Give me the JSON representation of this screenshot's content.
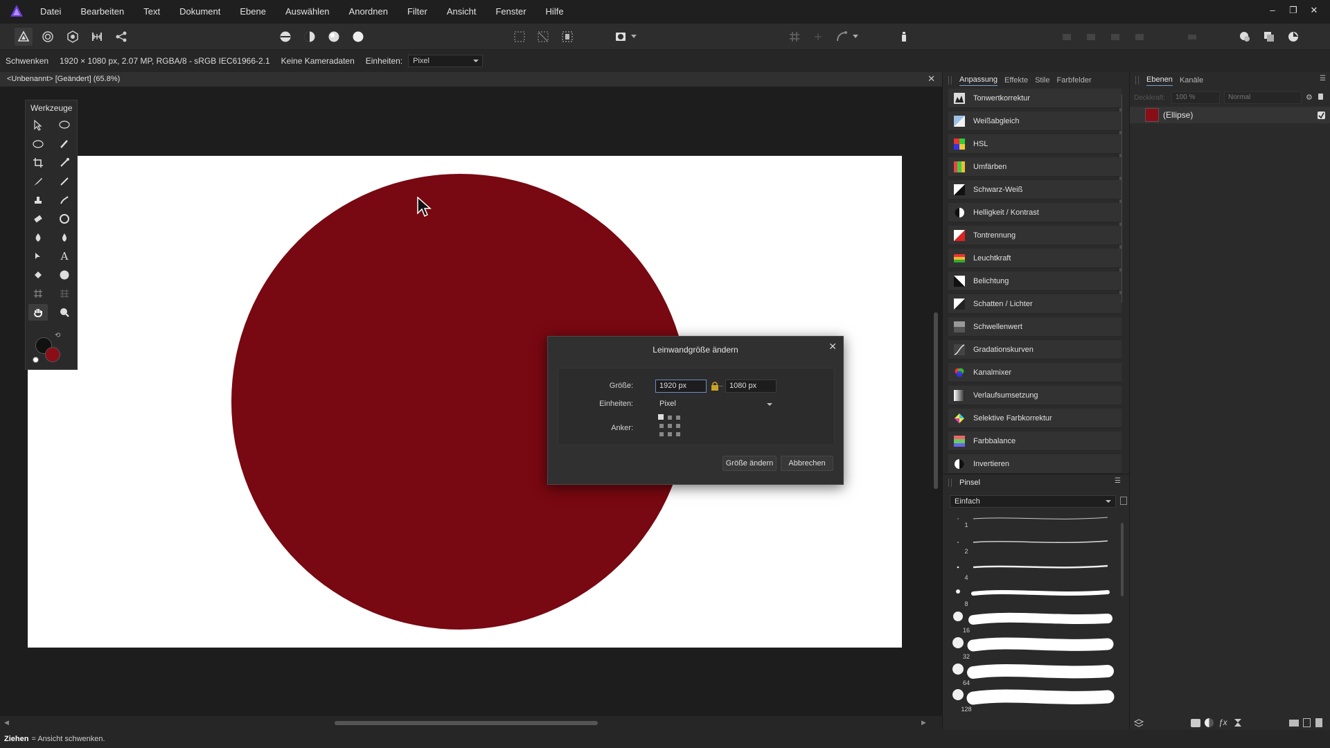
{
  "app": {
    "menu": [
      "Datei",
      "Bearbeiten",
      "Text",
      "Dokument",
      "Ebene",
      "Auswählen",
      "Anordnen",
      "Filter",
      "Ansicht",
      "Fenster",
      "Hilfe"
    ],
    "window_controls": [
      "–",
      "❐",
      "✕"
    ]
  },
  "context": {
    "tool_name": "Schwenken",
    "doc_info": "1920 × 1080 px, 2.07 MP, RGBA/8 - sRGB IEC61966-2.1",
    "camera": "Keine Kameradaten",
    "units_label": "Einheiten:",
    "units_value": "Pixel"
  },
  "document": {
    "tab_label": "<Unbenannt> [Geändert] (65.8%)",
    "tab_close": "✕",
    "ellipse_color": "#780811",
    "canvas_color": "#ffffff"
  },
  "tools": {
    "title": "Werkzeuge",
    "primary_color": "#111111",
    "secondary_color": "#8a0e18"
  },
  "dialog": {
    "title": "Leinwandgröße ändern",
    "close": "✕",
    "size_label": "Größe:",
    "width_value": "1920 px",
    "height_value": "1080 px",
    "units_label": "Einheiten:",
    "units_value": "Pixel",
    "anchor_label": "Anker:",
    "ok_label": "Größe ändern",
    "cancel_label": "Abbrechen"
  },
  "adjustments": {
    "tabs": [
      "Anpassung",
      "Effekte",
      "Stile",
      "Farbfelder"
    ],
    "items": [
      "Tonwertkorrektur",
      "Weißabgleich",
      "HSL",
      "Umfärben",
      "Schwarz-Weiß",
      "Helligkeit / Kontrast",
      "Tontrennung",
      "Leuchtkraft",
      "Belichtung",
      "Schatten / Lichter",
      "Schwellenwert",
      "Gradationskurven",
      "Kanalmixer",
      "Verlaufsumsetzung",
      "Selektive Farbkorrektur",
      "Farbbalance",
      "Invertieren"
    ]
  },
  "brushes": {
    "tab": "Pinsel",
    "category": "Einfach",
    "sizes": [
      "1",
      "2",
      "4",
      "8",
      "16",
      "32",
      "64",
      "128"
    ]
  },
  "layers": {
    "tabs": [
      "Ebenen",
      "Kanäle"
    ],
    "opacity_label": "Deckkraft:",
    "opacity_value": "100 %",
    "blend_mode": "Normal",
    "layer_name": "(Ellipse)"
  },
  "status": {
    "bold": "Ziehen",
    "text": "= Ansicht schwenken."
  }
}
